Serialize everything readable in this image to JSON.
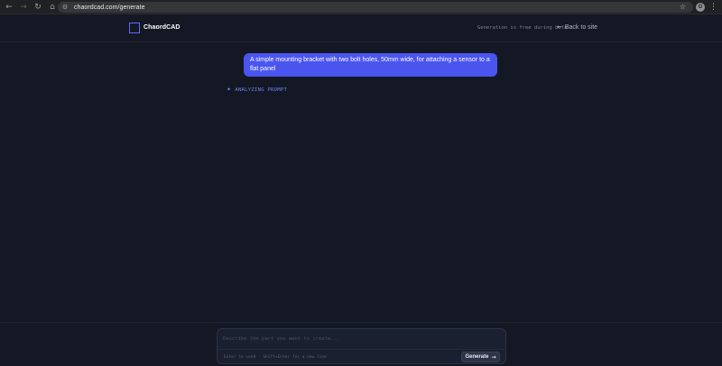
{
  "browser": {
    "url": "chaordcad.com/generate",
    "profile_initial": "G",
    "icons": {
      "back": "arrow-left-icon",
      "forward": "arrow-right-icon",
      "reload": "reload-icon",
      "home": "home-icon",
      "site_info": "site-info-icon",
      "bookmark": "star-icon",
      "menu": "kebab-menu-icon"
    }
  },
  "header": {
    "logo_text": "ChaordCAD",
    "beta_note": "Generation is free during beta",
    "back_link": "Back to site"
  },
  "chat": {
    "user_message": "A simple mounting bracket with two bolt holes, 50mm wide, for attaching a sensor to a flat panel",
    "status": "ANALYZING PROMPT"
  },
  "composer": {
    "placeholder": "Describe the part you want to create...",
    "hint": "Enter to send · Shift+Enter for a new line",
    "generate_label": "Generate"
  },
  "colors": {
    "background": "#141824",
    "accent": "#4a55f0",
    "status": "#6f85ff"
  }
}
